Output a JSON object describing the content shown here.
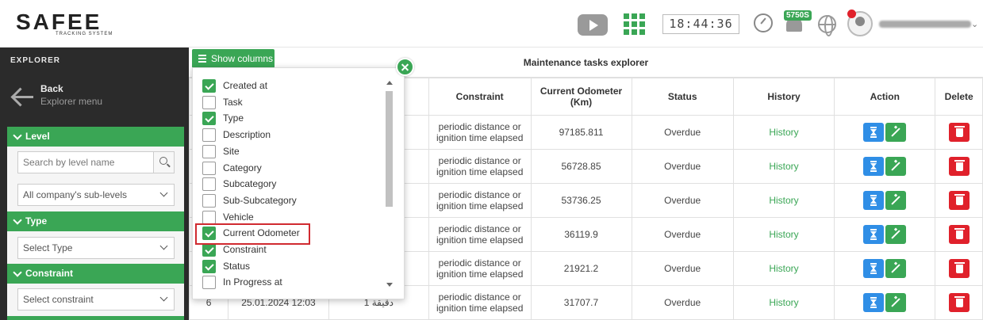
{
  "brand": {
    "logo": "SAFEE",
    "tagline": "TRACKING SYSTEM"
  },
  "header": {
    "clock": "18:44:36",
    "notifications_count": "5750S"
  },
  "sidebar": {
    "title": "EXPLORER",
    "back_label": "Back",
    "back_sub": "Explorer menu",
    "level": {
      "title": "Level",
      "search_placeholder": "Search by level name",
      "select": "All company's sub-levels"
    },
    "type": {
      "title": "Type",
      "select": "Select Type"
    },
    "constraint": {
      "title": "Constraint",
      "select": "Select constraint"
    }
  },
  "main": {
    "title": "Maintenance tasks explorer",
    "show_columns_label": "Show columns",
    "columns": [
      "Constraint",
      "Current Odometer (Km)",
      "Status",
      "History",
      "Action",
      "Delete"
    ],
    "rows": [
      {
        "constraint": "periodic distance or ignition time elapsed",
        "odometer": "97185.811",
        "status": "Overdue",
        "history": "History"
      },
      {
        "constraint": "periodic distance or ignition time elapsed",
        "odometer": "56728.85",
        "status": "Overdue",
        "history": "History"
      },
      {
        "constraint": "periodic distance or ignition time elapsed",
        "odometer": "53736.25",
        "status": "Overdue",
        "history": "History"
      },
      {
        "constraint": "periodic distance or ignition time elapsed",
        "odometer": "36119.9",
        "status": "Overdue",
        "history": "History"
      },
      {
        "constraint": "periodic distance or ignition time elapsed",
        "odometer": "21921.2",
        "status": "Overdue",
        "history": "History"
      },
      {
        "constraint": "periodic distance or ignition time elapsed",
        "odometer": "31707.7",
        "status": "Overdue",
        "history": "History"
      }
    ],
    "partial_row": {
      "index": "6",
      "date": "25.01.2024 12:03",
      "type": "1 دقيقة"
    }
  },
  "column_picker": {
    "options": [
      {
        "label": "Created at",
        "checked": true
      },
      {
        "label": "Task",
        "checked": false
      },
      {
        "label": "Type",
        "checked": true
      },
      {
        "label": "Description",
        "checked": false
      },
      {
        "label": "Site",
        "checked": false
      },
      {
        "label": "Category",
        "checked": false
      },
      {
        "label": "Subcategory",
        "checked": false
      },
      {
        "label": "Sub-Subcategory",
        "checked": false
      },
      {
        "label": "Vehicle",
        "checked": false
      },
      {
        "label": "Current Odometer",
        "checked": true
      },
      {
        "label": "Constraint",
        "checked": true
      },
      {
        "label": "Status",
        "checked": true
      },
      {
        "label": "In Progress at",
        "checked": false
      }
    ]
  },
  "colors": {
    "accent": "#3aa655",
    "danger": "#e0212b",
    "info": "#2f8ee6"
  }
}
